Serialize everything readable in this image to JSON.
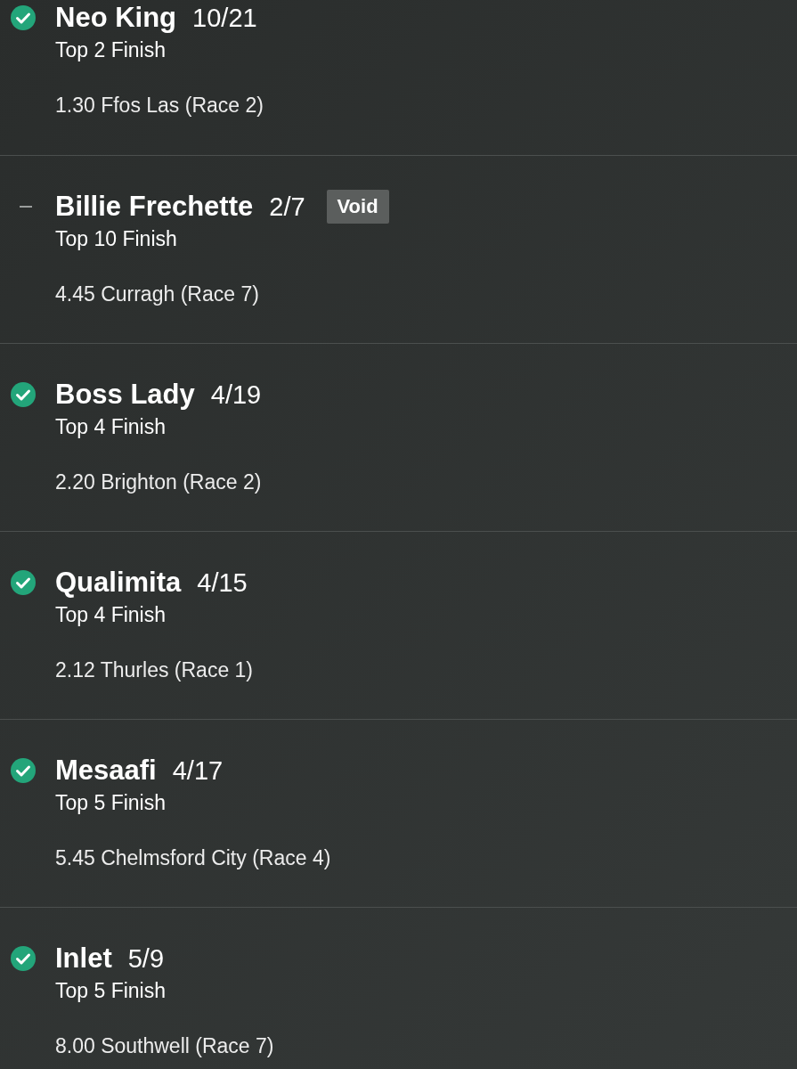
{
  "selections": [
    {
      "kind": "won",
      "name": "Neo King",
      "odds": "10/21",
      "market": "Top 2 Finish",
      "race": "1.30 Ffos Las (Race 2)"
    },
    {
      "kind": "void",
      "name": "Billie Frechette",
      "odds": "2/7",
      "badge": "Void",
      "market": "Top 10 Finish",
      "race": "4.45 Curragh (Race 7)"
    },
    {
      "kind": "won",
      "name": "Boss Lady",
      "odds": "4/19",
      "market": "Top 4 Finish",
      "race": "2.20 Brighton (Race 2)"
    },
    {
      "kind": "won",
      "name": "Qualimita",
      "odds": "4/15",
      "market": "Top 4 Finish",
      "race": "2.12 Thurles (Race 1)"
    },
    {
      "kind": "won",
      "name": "Mesaafi",
      "odds": "4/17",
      "market": "Top 5 Finish",
      "race": "5.45 Chelmsford City (Race 4)"
    },
    {
      "kind": "won",
      "name": "Inlet",
      "odds": "5/9",
      "market": "Top 5 Finish",
      "race": "8.00 Southwell (Race 7)"
    }
  ]
}
